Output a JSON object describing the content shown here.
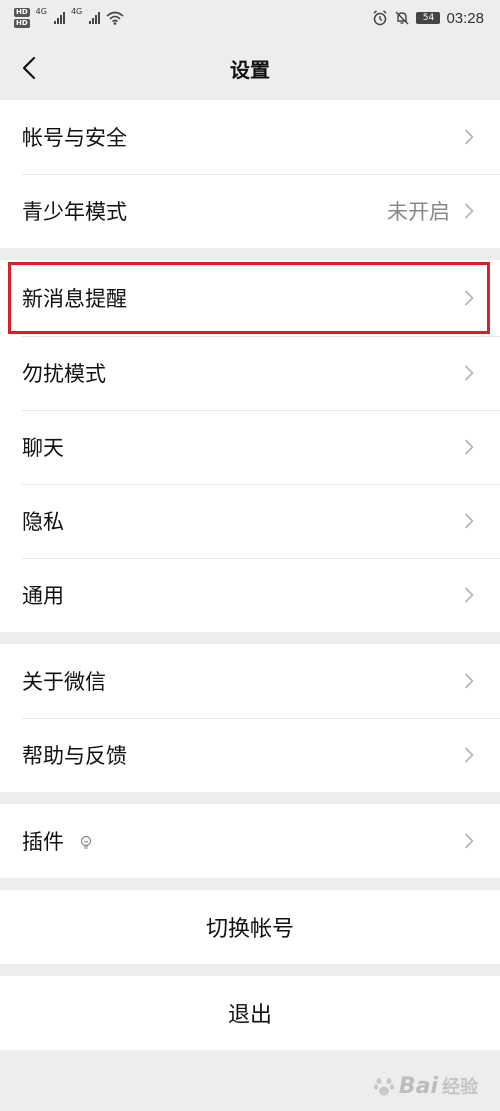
{
  "status": {
    "hd1": "HD",
    "hd2": "HD",
    "net1": "4G",
    "net2": "4G",
    "battery": "54",
    "time": "03:28"
  },
  "header": {
    "title": "设置"
  },
  "groups": [
    [
      {
        "label": "帐号与安全"
      },
      {
        "label": "青少年模式",
        "value": "未开启"
      }
    ],
    [
      {
        "label": "新消息提醒",
        "highlighted": true
      },
      {
        "label": "勿扰模式"
      },
      {
        "label": "聊天"
      },
      {
        "label": "隐私"
      },
      {
        "label": "通用"
      }
    ],
    [
      {
        "label": "关于微信"
      },
      {
        "label": "帮助与反馈"
      }
    ],
    [
      {
        "label": "插件"
      }
    ]
  ],
  "actions": {
    "switch_account": "切换帐号",
    "logout": "退出"
  },
  "watermark": {
    "brand": "Bai",
    "sub": "经验"
  },
  "colors": {
    "highlight": "#d9202a",
    "background": "#ededed"
  }
}
